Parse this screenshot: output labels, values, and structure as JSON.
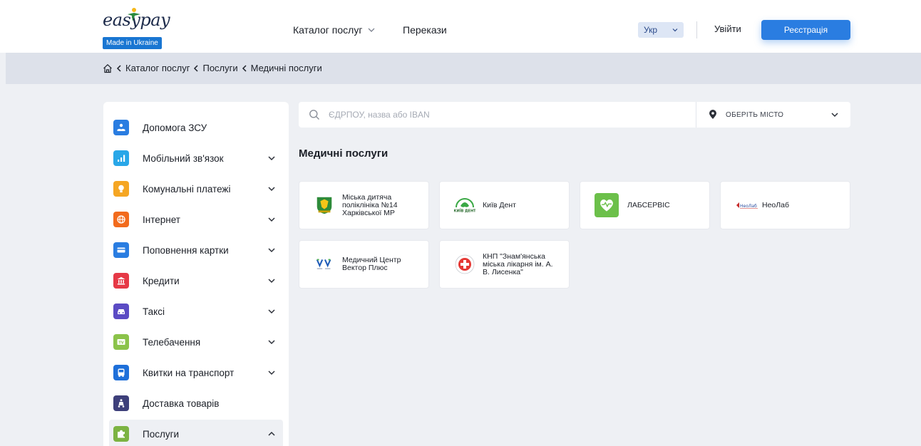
{
  "header": {
    "logo_text_easy": "easy",
    "logo_text_pay": "pay",
    "logo_badge": "Made in Ukraine",
    "nav_catalog": "Каталог послуг",
    "nav_transfers": "Перекази",
    "lang": "Укр",
    "login": "Увійти",
    "register": "Реєстрація"
  },
  "breadcrumb": {
    "items": [
      "Каталог послуг",
      "Послуги",
      "Медичні послуги"
    ]
  },
  "sidebar": {
    "items": [
      {
        "label": "Допомога ЗСУ",
        "icon": "donation-icon",
        "color": "#2a7de1",
        "expandable": false
      },
      {
        "label": "Мобільний зв'язок",
        "icon": "signal-bars-icon",
        "color": "#29a7e8",
        "expandable": true
      },
      {
        "label": "Комунальні платежі",
        "icon": "lightbulb-icon",
        "color": "#f5a623",
        "expandable": true
      },
      {
        "label": "Інтернет",
        "icon": "globe-icon",
        "color": "#f26b1d",
        "expandable": true
      },
      {
        "label": "Поповнення картки",
        "icon": "card-icon",
        "color": "#2a7de1",
        "expandable": true
      },
      {
        "label": "Кредити",
        "icon": "bank-icon",
        "color": "#e63946",
        "expandable": true
      },
      {
        "label": "Таксі",
        "icon": "car-icon",
        "color": "#5b4bc4",
        "expandable": true
      },
      {
        "label": "Телебачення",
        "icon": "tv-icon",
        "color": "#8bc34a",
        "expandable": true
      },
      {
        "label": "Квитки на транспорт",
        "icon": "bus-icon",
        "color": "#1e6fd9",
        "expandable": true
      },
      {
        "label": "Доставка товарів",
        "icon": "scooter-icon",
        "color": "#3d3f7a",
        "expandable": false
      },
      {
        "label": "Послуги",
        "icon": "puzzle-icon",
        "color": "#7cb342",
        "expandable": true,
        "expanded": true
      }
    ]
  },
  "search": {
    "placeholder": "ЄДРПОУ, назва або IBAN",
    "city_label": "ОБЕРІТЬ МІСТО"
  },
  "main": {
    "title": "Медичні послуги",
    "cards": [
      {
        "name": "Міська дитяча поліклініка №14 Харківської МР",
        "logo": "kharkiv-crest-icon"
      },
      {
        "name": "Київ Дент",
        "logo": "kyiv-dent-icon"
      },
      {
        "name": "ЛАБСЕРВІС",
        "logo": "heart-pulse-icon"
      },
      {
        "name": "НеоЛаб",
        "logo": "neolab-icon"
      },
      {
        "name": "Медичний Центр Вектор Плюс",
        "logo": "vector-plus-icon"
      },
      {
        "name": "КНП \"Знам'янська міська лікарня ім. А. В. Лисенка\"",
        "logo": "red-cross-icon"
      }
    ]
  }
}
